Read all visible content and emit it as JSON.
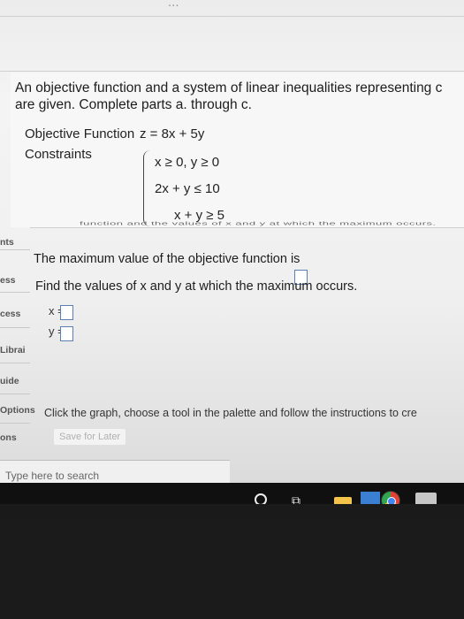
{
  "header": {
    "partial_title": "..."
  },
  "question": {
    "intro_line1": "An objective function and a system of linear inequalities representing c",
    "intro_line2": "are given. Complete parts a. through c.",
    "objective_label": "Objective Function",
    "objective_expr": "z = 8x + 5y",
    "constraints_label": "Constraints",
    "constraints": [
      "x ≥ 0, y ≥ 0",
      "2x + y ≤ 10",
      "x + y ≥ 5"
    ],
    "overflow_text": "function and the values of x and y at which the maximum occurs.",
    "max_value_prompt": "The maximum value of the objective function is",
    "find_xy_prompt": "Find the values of x and y at which the maximum occurs.",
    "x_label": "x =",
    "y_label": "y =",
    "graph_instructions": "Click the graph, choose a tool in the palette and follow the instructions to cre",
    "save_later": "Save for Later"
  },
  "sidebar": {
    "items": [
      "nts",
      "ess",
      "cess",
      "Librai",
      "uide",
      "Options",
      "ons"
    ]
  },
  "taskbar": {
    "search_placeholder": "Type here to search"
  },
  "colors": {
    "answer_box_border": "#5a7fb5",
    "taskbar": "#101010"
  }
}
